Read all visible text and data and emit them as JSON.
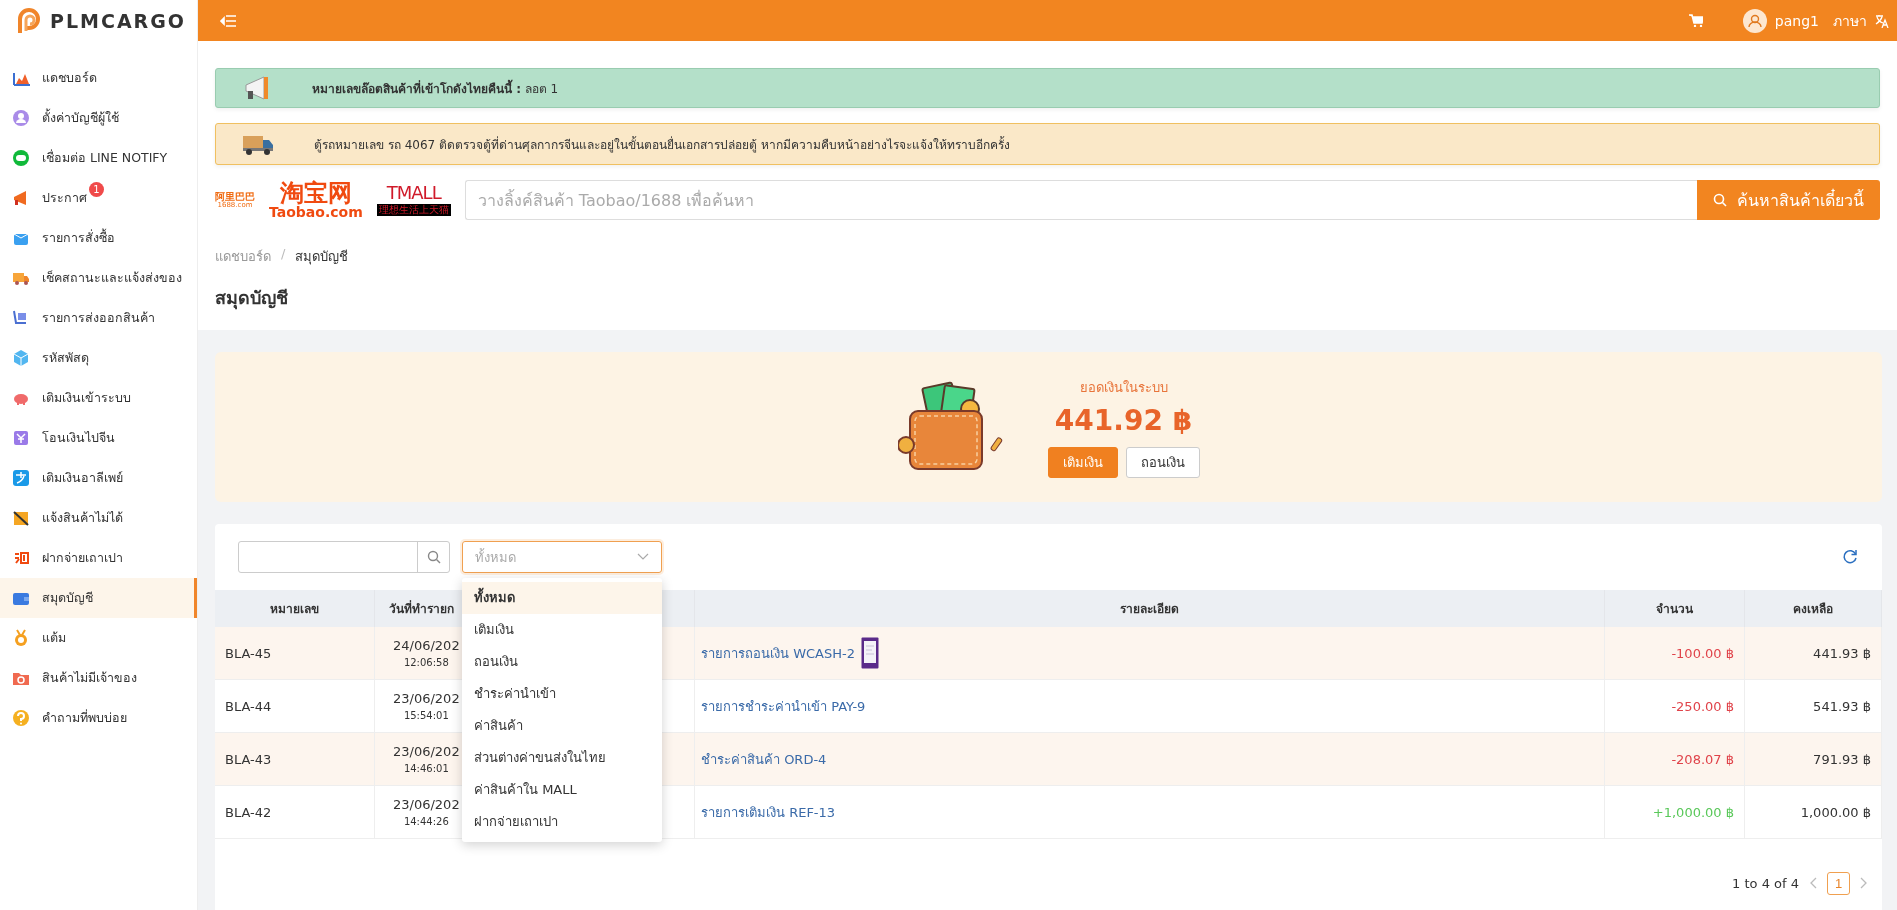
{
  "header": {
    "username": "pang1",
    "language": "ภาษา"
  },
  "sidebar": {
    "logo": "PLMCARGO",
    "items": [
      {
        "label": "แดชบอร์ด",
        "selected": false
      },
      {
        "label": "ตั้งค่าบัญชีผู้ใช้",
        "selected": false
      },
      {
        "label": "เชื่อมต่อ LINE NOTIFY",
        "selected": false
      },
      {
        "label": "ประกาศ",
        "selected": false,
        "badge": "1"
      },
      {
        "label": "รายการสั่งซื้อ",
        "selected": false
      },
      {
        "label": "เช็คสถานะและแจ้งส่งของ",
        "selected": false
      },
      {
        "label": "รายการส่งออกสินค้า",
        "selected": false
      },
      {
        "label": "รหัสพัสดุ",
        "selected": false
      },
      {
        "label": "เติมเงินเข้าระบบ",
        "selected": false
      },
      {
        "label": "โอนเงินไปจีน",
        "selected": false
      },
      {
        "label": "เติมเงินอาลีเพย์",
        "selected": false
      },
      {
        "label": "แจ้งสินค้าไม่ได้",
        "selected": false
      },
      {
        "label": "ฝากจ่ายเถาเปา",
        "selected": false
      },
      {
        "label": "สมุดบัญชี",
        "selected": true
      },
      {
        "label": "แต้ม",
        "selected": false
      },
      {
        "label": "สินค้าไม่มีเจ้าของ",
        "selected": false
      },
      {
        "label": "คำถามที่พบบ่อย",
        "selected": false
      }
    ]
  },
  "notices": [
    {
      "kind": "success",
      "text": "**หมายเลขล๊อตสินค้าที่เข้าโกดังไทยคืนนี้ :** ลอต 1"
    },
    {
      "kind": "warning",
      "text": "ตู้รถหมายเลข รถ 4067 ติดตรวจตู้ที่ด่านศุลกากรจีนและอยู่ในขั้นตอนยื่นเอกสารปล่อยตู้ หากมีความคืบหน้าอย่างไรจะแจ้งให้ทราบอีกครั้ง"
    }
  ],
  "marketplaces": [
    {
      "kind": "alibaba",
      "text": "阿里巴巴",
      "subtext": "1688.com"
    },
    {
      "kind": "taobao",
      "text": "淘宝网",
      "subtext": "Taobao.com"
    },
    {
      "kind": "tmall",
      "text": "TMALL",
      "subtext": "理想生活上天猫"
    }
  ],
  "search": {
    "placeholder": "วางลิ้งค์สินค้า Taobao/1688 เพื่อค้นหา",
    "button": "ค้นหาสินค้าเดี๋ยวนี้"
  },
  "breadcrumb": {
    "separator": "/",
    "items": [
      "แดชบอร์ด",
      "สมุดบัญชี"
    ]
  },
  "page_title": "สมุดบัญชี",
  "wallet": {
    "label": "ยอดเงินในระบบ",
    "amount": "441.92 ฿",
    "buttons": [
      {
        "label": "เติมเงิน",
        "kind": "primary"
      },
      {
        "label": "ถอนเงิน",
        "kind": "default"
      }
    ]
  },
  "type_filter": {
    "placeholder": "ทั้งหมด",
    "expanded": true,
    "options": [
      {
        "label": "ทั้งหมด",
        "selected": true
      },
      {
        "label": "เติมเงิน",
        "selected": false
      },
      {
        "label": "ถอนเงิน",
        "selected": false
      },
      {
        "label": "ชำระค่านำเข้า",
        "selected": false
      },
      {
        "label": "ค่าสินค้า",
        "selected": false
      },
      {
        "label": "ส่วนต่างค่าขนส่งในไทย",
        "selected": false
      },
      {
        "label": "ค่าสินค้าใน MALL",
        "selected": false
      },
      {
        "label": "ฝากจ่ายเถาเปา",
        "selected": false
      }
    ]
  },
  "table": {
    "columns": [
      "หมายเลข",
      "วันที่ทำรายก",
      "รายละเอียด",
      "จำนวน",
      "คงเหลือ"
    ],
    "rows": [
      {
        "id": "BLA-45",
        "date": "24/06/202",
        "time": "12:06:58",
        "detail": "รายการถอนเงิน WCASH-2",
        "attachment": true,
        "amount": "-100.00 ฿",
        "credit": false,
        "balance": "441.93 ฿",
        "highlighted": true
      },
      {
        "id": "BLA-44",
        "date": "23/06/202",
        "time": "15:54:01",
        "detail": "รายการชำระค่านำเข้า PAY-9",
        "attachment": false,
        "amount": "-250.00 ฿",
        "credit": false,
        "balance": "541.93 ฿",
        "highlighted": false
      },
      {
        "id": "BLA-43",
        "date": "23/06/202",
        "time": "14:46:01",
        "detail": "ชำระค่าสินค้า ORD-4",
        "attachment": false,
        "amount": "-208.07 ฿",
        "credit": false,
        "balance": "791.93 ฿",
        "highlighted": true
      },
      {
        "id": "BLA-42",
        "date": "23/06/202",
        "time": "14:44:26",
        "detail": "รายการเติมเงิน REF-13",
        "attachment": false,
        "amount": "+1,000.00 ฿",
        "credit": true,
        "balance": "1,000.00 ฿",
        "highlighted": false
      }
    ]
  },
  "pagination": {
    "summary": "1 to 4 of 4",
    "pages": [
      {
        "label": "1",
        "selected": true
      }
    ]
  }
}
